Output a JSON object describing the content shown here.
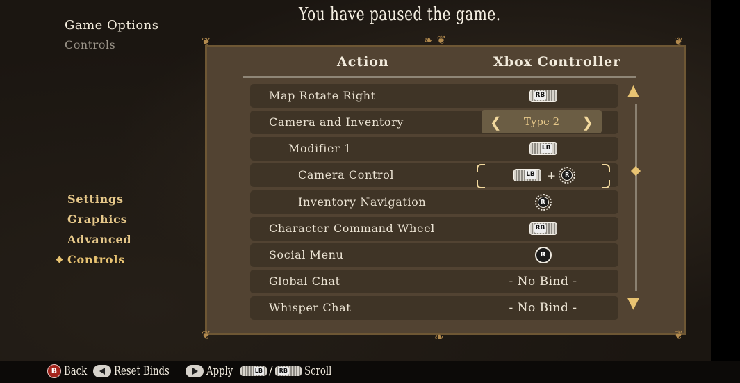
{
  "header": {
    "title": "Game Options",
    "subtitle": "Controls",
    "pause_message": "You have paused the game."
  },
  "menu": {
    "items": [
      {
        "label": "Settings",
        "active": false
      },
      {
        "label": "Graphics",
        "active": false
      },
      {
        "label": "Advanced",
        "active": false
      },
      {
        "label": "Controls",
        "active": true
      }
    ]
  },
  "table": {
    "columns": [
      "Action",
      "Xbox Controller"
    ],
    "rows": [
      {
        "action": "Map Rotate Right",
        "binding": "RB"
      },
      {
        "action": "Camera and Inventory",
        "binding": "Type 2"
      },
      {
        "action": "Modifier 1",
        "binding": "LB"
      },
      {
        "action": "Camera Control",
        "binding": "LB + R"
      },
      {
        "action": "Inventory Navigation",
        "binding": "R"
      },
      {
        "action": "Character Command Wheel",
        "binding": "RB"
      },
      {
        "action": "Social Menu",
        "binding": "R"
      },
      {
        "action": "Global Chat",
        "binding": "- No Bind -"
      },
      {
        "action": "Whisper Chat",
        "binding": "- No Bind -"
      }
    ],
    "button_labels": {
      "rb": "RB",
      "lb": "LB",
      "r": "R",
      "b": "B",
      "plus": "+"
    }
  },
  "footer": {
    "back": "Back",
    "reset": "Reset Binds",
    "apply": "Apply",
    "scroll": "Scroll",
    "slash": "/"
  },
  "colors": {
    "accent": "#e8c372",
    "panel": "#524332",
    "row": "#3f3426",
    "text": "#ece4d4"
  }
}
